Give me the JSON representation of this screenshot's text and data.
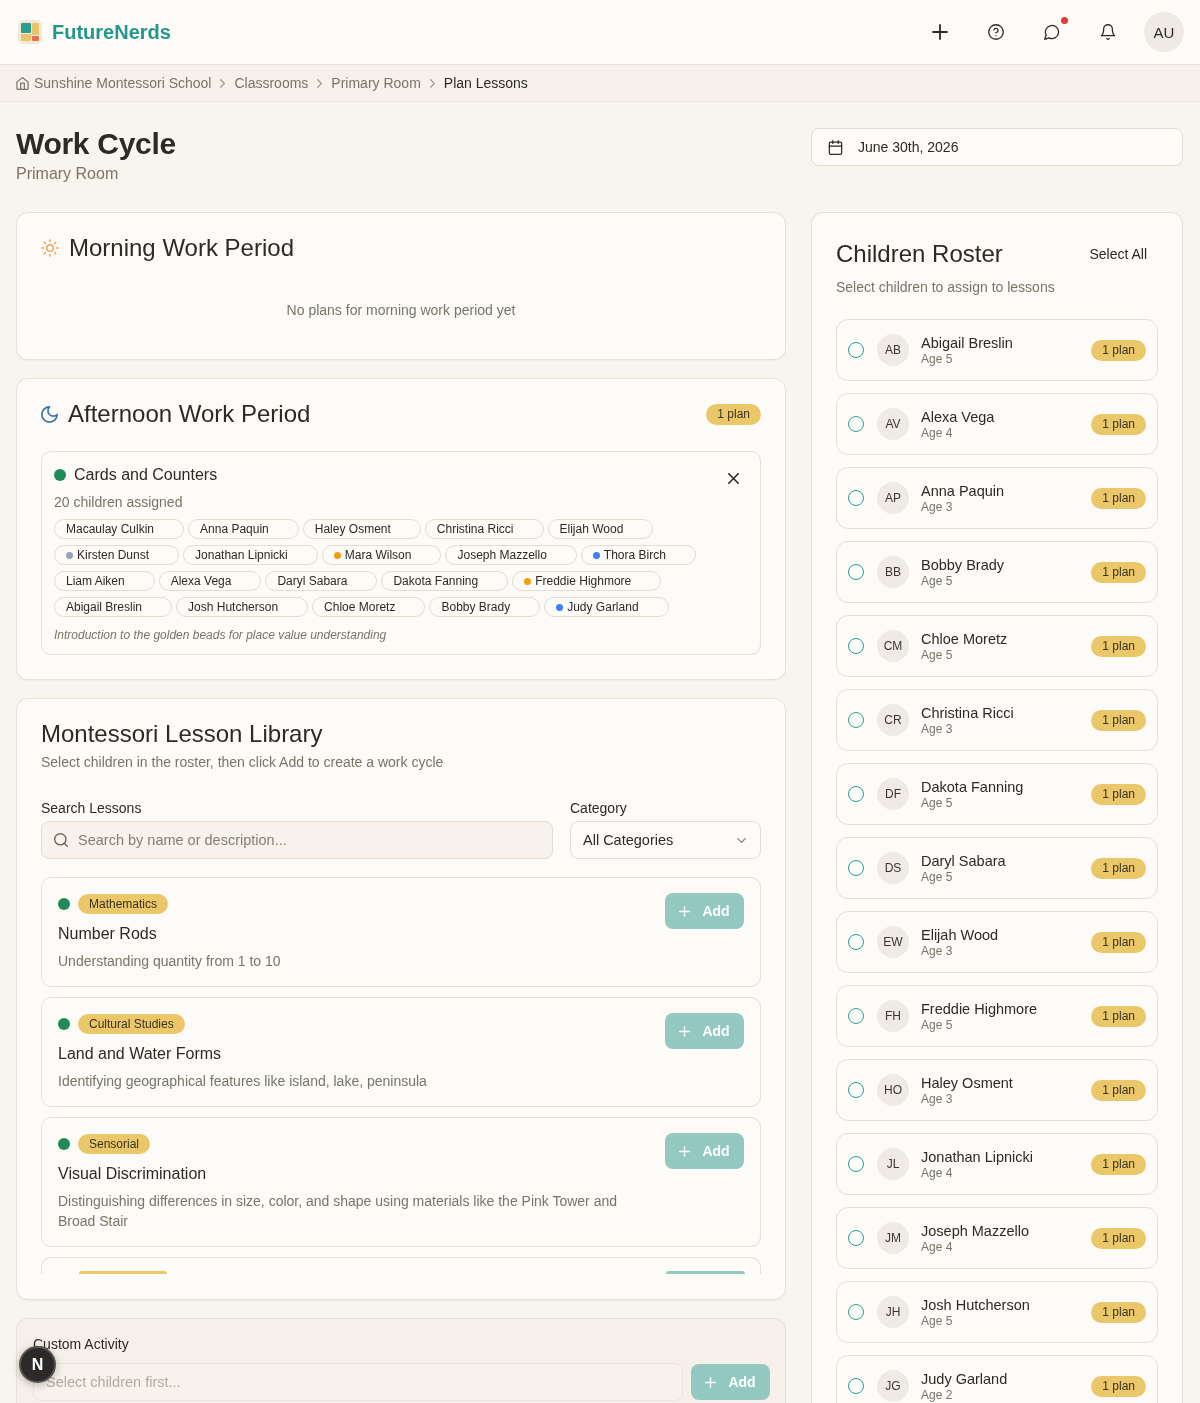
{
  "header": {
    "brand": "FutureNerds",
    "actions": [
      {
        "kind": "add",
        "unread": false
      },
      {
        "kind": "help",
        "unread": false
      },
      {
        "kind": "messages",
        "unread": true
      },
      {
        "kind": "notifications",
        "unread": false
      }
    ],
    "avatar": "AU"
  },
  "breadcrumb": [
    {
      "kind": "home",
      "label": "Sunshine Montessori School",
      "current": false
    },
    {
      "kind": "link",
      "label": "Classrooms",
      "current": false
    },
    {
      "kind": "link",
      "label": "Primary Room",
      "current": false
    },
    {
      "kind": "link",
      "label": "Plan Lessons",
      "current": true
    }
  ],
  "page": {
    "title": "Work Cycle",
    "subtitle": "Primary Room"
  },
  "date_picker": {
    "value": "June 30th, 2026"
  },
  "periods": [
    {
      "kind": "morning",
      "title": "Morning Work Period",
      "empty_text": "No plans for morning work period yet"
    },
    {
      "kind": "afternoon",
      "title": "Afternoon Work Period",
      "badge": "1 plan",
      "plans": [
        {
          "title": "Cards and Counters",
          "assigned": "20 children assigned",
          "students": [
            {
              "name": "Macaulay Culkin"
            },
            {
              "name": "Anna Paquin"
            },
            {
              "name": "Haley Osment"
            },
            {
              "name": "Christina Ricci"
            },
            {
              "name": "Elijah Wood"
            },
            {
              "name": "Kirsten Dunst",
              "color": "#94a3b8"
            },
            {
              "name": "Jonathan Lipnicki"
            },
            {
              "name": "Mara Wilson",
              "color": "#f59e0b"
            },
            {
              "name": "Joseph Mazzello"
            },
            {
              "name": "Thora Birch",
              "color": "#3b82f6"
            },
            {
              "name": "Liam Aiken"
            },
            {
              "name": "Alexa Vega"
            },
            {
              "name": "Daryl Sabara"
            },
            {
              "name": "Dakota Fanning"
            },
            {
              "name": "Freddie Highmore",
              "color": "#f59e0b"
            },
            {
              "name": "Abigail Breslin"
            },
            {
              "name": "Josh Hutcherson"
            },
            {
              "name": "Chloe Moretz"
            },
            {
              "name": "Bobby Brady"
            },
            {
              "name": "Judy Garland",
              "color": "#3b82f6"
            }
          ],
          "note": "Introduction to the golden beads for place value understanding"
        }
      ]
    }
  ],
  "library": {
    "title": "Montessori Lesson Library",
    "subtitle": "Select children in the roster, then click Add to create a work cycle",
    "search": {
      "label": "Search Lessons",
      "placeholder": "Search by name or description..."
    },
    "category": {
      "label": "Category",
      "value": "All Categories"
    },
    "lessons": [
      {
        "kind": "lesson",
        "category": "Mathematics",
        "title": "Number Rods",
        "description": "Understanding quantity from 1 to 10",
        "button": "Add",
        "disabled": true
      },
      {
        "kind": "lesson",
        "category": "Cultural Studies",
        "title": "Land and Water Forms",
        "description": "Identifying geographical features like island, lake, peninsula",
        "button": "Add",
        "disabled": true
      },
      {
        "kind": "lesson",
        "category": "Sensorial",
        "title": "Visual Discrimination",
        "description": "Distinguishing differences in size, color, and shape using materials like the Pink Tower and Broad Stair",
        "button": "Add",
        "disabled": true
      },
      {
        "kind": "cut-off",
        "disabled": true
      }
    ]
  },
  "custom_activity": {
    "label": "Custom Activity",
    "placeholder": "Select children first...",
    "button": "Add",
    "disabled": true
  },
  "roster": {
    "title": "Children Roster",
    "select_all": "Select All",
    "subtitle": "Select children to assign to lessons",
    "students": [
      {
        "initials": "AB",
        "name": "Abigail Breslin",
        "age": "Age 5",
        "badge": "1 plan",
        "selected": false
      },
      {
        "initials": "AV",
        "name": "Alexa Vega",
        "age": "Age 4",
        "badge": "1 plan",
        "selected": false
      },
      {
        "initials": "AP",
        "name": "Anna Paquin",
        "age": "Age 3",
        "badge": "1 plan",
        "selected": false
      },
      {
        "initials": "BB",
        "name": "Bobby Brady",
        "age": "Age 5",
        "badge": "1 plan",
        "selected": false
      },
      {
        "initials": "CM",
        "name": "Chloe Moretz",
        "age": "Age 5",
        "badge": "1 plan",
        "selected": false
      },
      {
        "initials": "CR",
        "name": "Christina Ricci",
        "age": "Age 3",
        "badge": "1 plan",
        "selected": false
      },
      {
        "initials": "DF",
        "name": "Dakota Fanning",
        "age": "Age 5",
        "badge": "1 plan",
        "selected": false
      },
      {
        "initials": "DS",
        "name": "Daryl Sabara",
        "age": "Age 5",
        "badge": "1 plan",
        "selected": false
      },
      {
        "initials": "EW",
        "name": "Elijah Wood",
        "age": "Age 3",
        "badge": "1 plan",
        "selected": false
      },
      {
        "initials": "FH",
        "name": "Freddie Highmore",
        "age": "Age 5",
        "badge": "1 plan",
        "selected": false
      },
      {
        "initials": "HO",
        "name": "Haley Osment",
        "age": "Age 3",
        "badge": "1 plan",
        "selected": false
      },
      {
        "initials": "JL",
        "name": "Jonathan Lipnicki",
        "age": "Age 4",
        "badge": "1 plan",
        "selected": false
      },
      {
        "initials": "JM",
        "name": "Joseph Mazzello",
        "age": "Age 4",
        "badge": "1 plan",
        "selected": false
      },
      {
        "initials": "JH",
        "name": "Josh Hutcherson",
        "age": "Age 5",
        "badge": "1 plan",
        "selected": false
      },
      {
        "initials": "JG",
        "name": "Judy Garland",
        "age": "Age 2",
        "badge": "1 plan",
        "selected": false
      }
    ]
  },
  "dev_indicator": {
    "label": "N"
  }
}
